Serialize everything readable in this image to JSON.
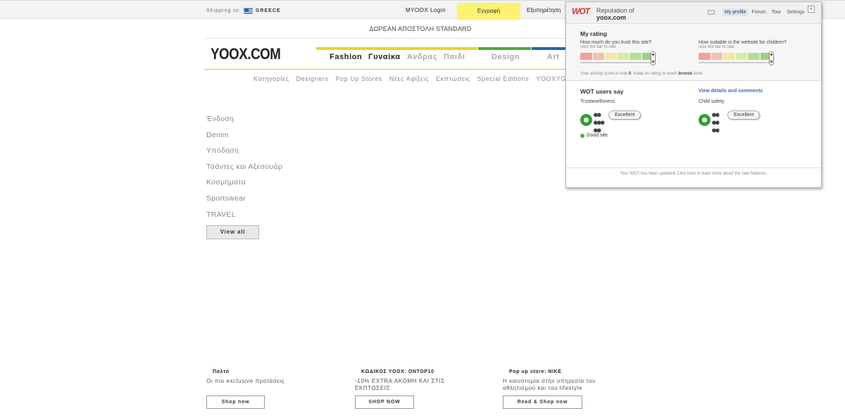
{
  "topbar": {
    "shipping_label": "Shipping to:",
    "shipping_country": "GREECE",
    "login": "MYOOX Login",
    "register": "Εγγραφή",
    "service": "Εξυπηρέτηση"
  },
  "banner": {
    "free_shipping": "ΔΩΡΕΑΝ ΑΠΟΣΤΟΛΗ STANDARD"
  },
  "logo": "YOOX.COM",
  "main_nav": [
    {
      "label": "Fashion",
      "color": "#e6d42a",
      "text_color": "#222"
    },
    {
      "label": "Γυναίκα",
      "color": "#e6d42a",
      "text_color": "#222"
    },
    {
      "label": "Άνδρας",
      "color": "#e6d42a",
      "text_color": "#aaa"
    },
    {
      "label": "Παιδί",
      "color": "#e6d42a",
      "text_color": "#aaa"
    },
    {
      "label": "Design",
      "color": "#4caa44",
      "text_color": "#aaa"
    },
    {
      "label": "Art",
      "color": "#2a62b5",
      "text_color": "#aaa"
    }
  ],
  "sub_nav": [
    "Κατηγορίες",
    "Designers",
    "Pop Up Stores",
    "Νέες Αφίξεις",
    "Εκπτώσεις",
    "Special Editions",
    "YOOXYGEN"
  ],
  "categories": [
    "Ένδυση",
    "Denim",
    "Υπόδηση",
    "Τσάντες και Αξεσουάρ",
    "Κοσμήματα",
    "Sportswear",
    "TRAVEL"
  ],
  "view_all": "View all",
  "promos": [
    {
      "title": "Παλτό",
      "text": "Οι πιο exclusive προτάσεις",
      "button": "Shop now"
    },
    {
      "title": "ΚΩΔΙΚΟΣ YOOX: ONTOP10",
      "text": "-10% EXTRA ΑΚΟΜΗ ΚΑΙ ΣΤΙΣ ΕΚΠΤΩΣΕΙΣ",
      "button": "SHOP NOW"
    },
    {
      "title": "Pop up store: NIKE",
      "text": "Η καινοτομία στην υπηρεσία του αθλητισμού και του lifestyle",
      "button": "Read & Shop now"
    }
  ],
  "wot": {
    "logo": "WOT",
    "reputation_of": "Reputation of",
    "site": "yoox.com",
    "tabs": [
      "My profile",
      "Forum",
      "Tour",
      "Settings"
    ],
    "close": "×",
    "my_rating": "My rating",
    "q_trust": "How much do you trust this site?",
    "q_children": "How suitable is the website for children?",
    "hint": "click the bar to rate",
    "activity_pre": "Your activity score is now",
    "activity_score": "0",
    "activity_mid": ". Keep on rating to reach",
    "activity_level": "bronze",
    "activity_post": "level",
    "users_say": "WOT users say",
    "details_link": "View details and comments",
    "trustworthiness": "Trustworthiness",
    "child_safety": "Child safety",
    "trust_verdict": "Excellent",
    "child_verdict": "Excellent",
    "good_site": "Good site",
    "footer": "Your WOT has been updated! Click here to learn more about the new features.",
    "rating_colors": [
      "#f2a0a0",
      "#f5c0b0",
      "#f2e8a8",
      "#d8eba8",
      "#b8dd98",
      "#9ccf80"
    ],
    "good_color": "#3ab54a"
  }
}
